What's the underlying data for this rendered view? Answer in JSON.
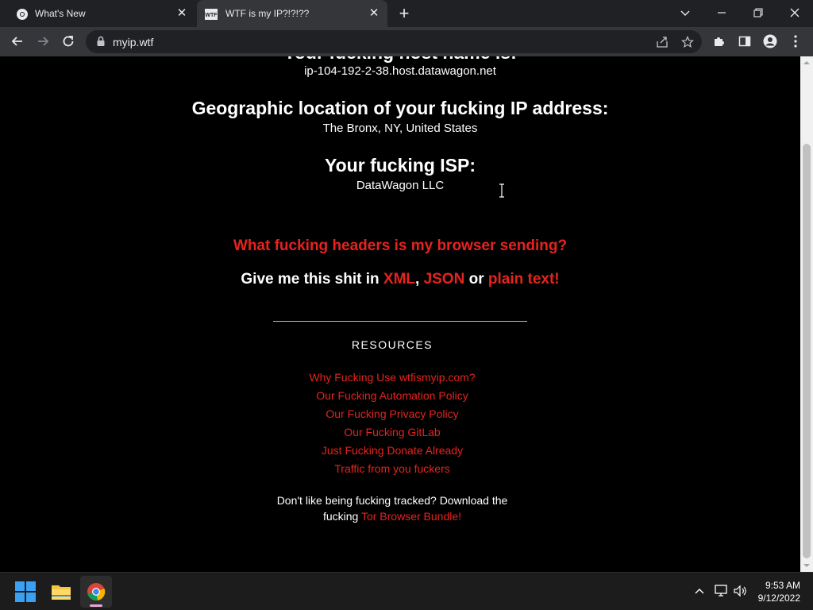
{
  "browser": {
    "tabs": [
      {
        "title": "What's New",
        "active": false
      },
      {
        "title": "WTF is my IP?!?!??",
        "active": true
      }
    ],
    "url": "myip.wtf"
  },
  "page": {
    "hostname_heading": "Your fucking host name is:",
    "hostname_value": "ip-104-192-2-38.host.datawagon.net",
    "geo_heading": "Geographic location of your fucking IP address:",
    "geo_value": "The Bronx, NY, United States",
    "isp_heading": "Your fucking ISP:",
    "isp_value": "DataWagon LLC",
    "headers_link": "What fucking headers is my browser sending?",
    "formats": {
      "prefix": "Give me this shit in ",
      "xml": "XML",
      "sep1": ", ",
      "json": "JSON",
      "sep2": " or ",
      "plain": "plain text!"
    },
    "resources_title": "RESOURCES",
    "resources": [
      "Why Fucking Use wtfismyip.com?",
      "Our Fucking Automation Policy",
      "Our Fucking Privacy Policy",
      "Our Fucking GitLab",
      "Just Fucking Donate Already",
      "Traffic from you fuckers"
    ],
    "tor_note": {
      "line1": "Don't like being fucking tracked? Download the",
      "line2_prefix": "fucking ",
      "link": "Tor Browser Bundle!"
    }
  },
  "taskbar": {
    "time": "9:53 AM",
    "date": "9/12/2022"
  },
  "colors": {
    "accent_red": "#e6231e",
    "page_bg": "#000000",
    "chrome_dark": "#202124",
    "chrome_toolbar": "#35363a"
  }
}
